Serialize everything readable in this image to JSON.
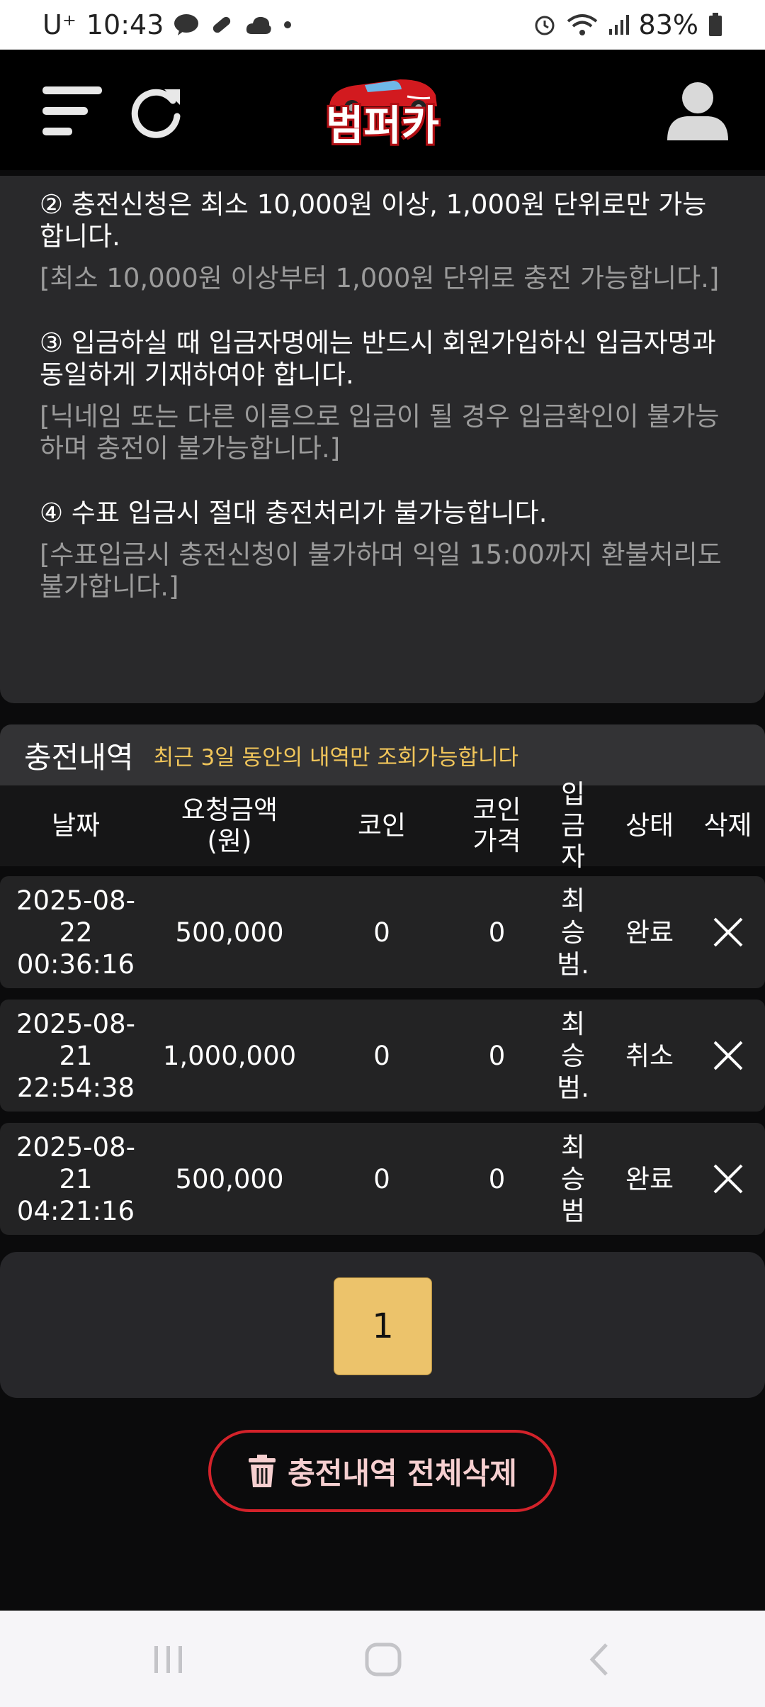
{
  "status_bar": {
    "carrier": "U⁺",
    "time": "10:43",
    "battery": "83%"
  },
  "header": {
    "logo_text": "범퍼카"
  },
  "notice": {
    "items": [
      {
        "title": "② 충전신청은 최소 10,000원 이상, 1,000원 단위로만 가능합니다.",
        "sub": "[최소 10,000원 이상부터 1,000원 단위로 충전 가능합니다.]"
      },
      {
        "title": "③ 입금하실 때 입금자명에는 반드시 회원가입하신 입금자명과 동일하게 기재하여야 합니다.",
        "sub": "[닉네임 또는 다른 이름으로 입금이 될 경우 입금확인이 불가능하며 충전이 불가능합니다.]"
      },
      {
        "title": "④ 수표 입금시 절대 충전처리가 불가능합니다.",
        "sub": "[수표입금시 충전신청이 불가하며 익일 15:00까지 환불처리도 불가합니다.]"
      }
    ]
  },
  "history": {
    "title": "충전내역",
    "note": "최근 3일 동안의 내역만 조회가능합니다",
    "columns": [
      "날짜",
      "요청금액 (원)",
      "코인",
      "코인 가격",
      "입금 자",
      "상태",
      "삭제"
    ],
    "rows": [
      {
        "date": "2025-08-22 00:36:16",
        "amount": "500,000",
        "coin": "0",
        "coin_price": "0",
        "depositor": "최승범.",
        "status": "완료"
      },
      {
        "date": "2025-08-21 22:54:38",
        "amount": "1,000,000",
        "coin": "0",
        "coin_price": "0",
        "depositor": "최승범.",
        "status": "취소"
      },
      {
        "date": "2025-08-21 04:21:16",
        "amount": "500,000",
        "coin": "0",
        "coin_price": "0",
        "depositor": "최승범",
        "status": "완료"
      }
    ]
  },
  "pagination": {
    "current_page": "1"
  },
  "actions": {
    "delete_all_label": "충전내역 전체삭제"
  },
  "colors": {
    "accent_gold": "#ecc36b",
    "note_yellow": "#f0c55a",
    "danger_red": "#d3222a"
  }
}
